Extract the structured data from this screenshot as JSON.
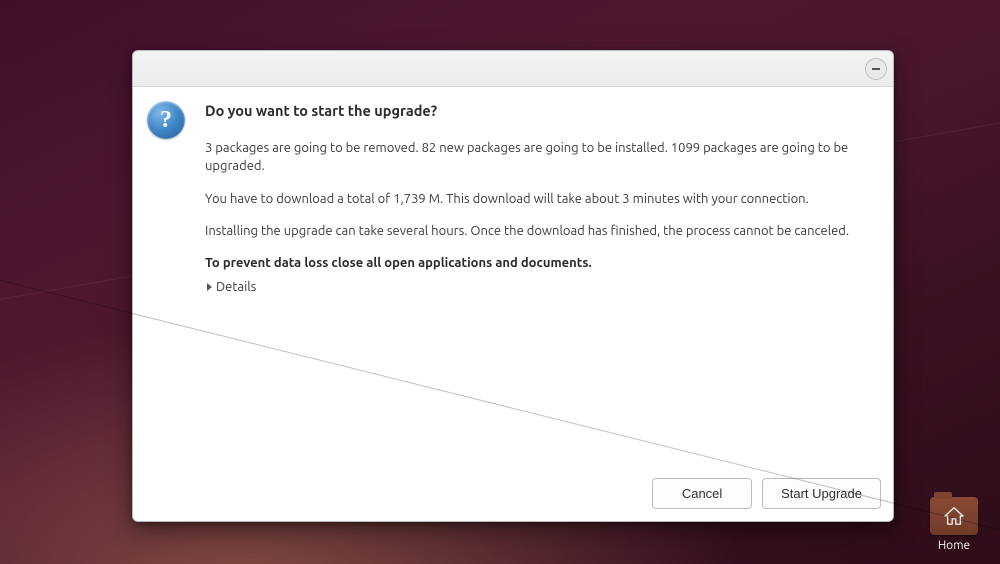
{
  "dialog": {
    "heading": "Do you want to start the upgrade?",
    "line_packages": "3 packages are going to be removed. 82 new packages are going to be installed. 1099 packages are going to be upgraded.",
    "line_download": "You have to download a total of 1,739 M. This download will take about 3 minutes with your connection.",
    "line_install": "Installing the upgrade can take several hours. Once the download has finished, the process cannot be canceled.",
    "line_warn": "To prevent data loss close all open applications and documents.",
    "details_label": "Details",
    "cancel_label": "Cancel",
    "start_label": "Start Upgrade"
  },
  "desktop": {
    "home_label": "Home"
  }
}
